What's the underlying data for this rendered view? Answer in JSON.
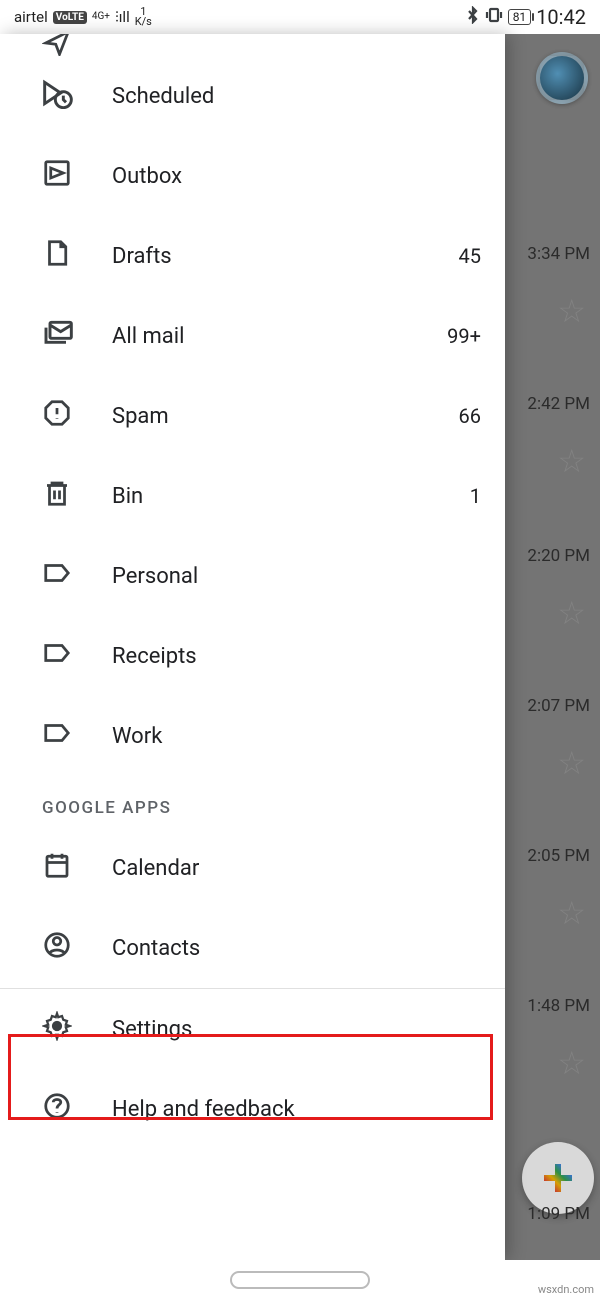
{
  "statusbar": {
    "carrier": "airtel",
    "volte": "VoLTE",
    "netgen": "4G+",
    "speed_top": "1",
    "speed_unit": "K/s",
    "battery": "81",
    "time": "10:42"
  },
  "drawer": {
    "items": [
      {
        "id": "sent",
        "label": "Sent",
        "count": ""
      },
      {
        "id": "scheduled",
        "label": "Scheduled",
        "count": ""
      },
      {
        "id": "outbox",
        "label": "Outbox",
        "count": ""
      },
      {
        "id": "drafts",
        "label": "Drafts",
        "count": "45"
      },
      {
        "id": "allmail",
        "label": "All mail",
        "count": "99+"
      },
      {
        "id": "spam",
        "label": "Spam",
        "count": "66"
      },
      {
        "id": "bin",
        "label": "Bin",
        "count": "1"
      },
      {
        "id": "personal",
        "label": "Personal",
        "count": ""
      },
      {
        "id": "receipts",
        "label": "Receipts",
        "count": ""
      },
      {
        "id": "work",
        "label": "Work",
        "count": ""
      }
    ],
    "section_google_apps": "GOOGLE APPS",
    "google_apps": [
      {
        "id": "calendar",
        "label": "Calendar"
      },
      {
        "id": "contacts",
        "label": "Contacts"
      }
    ],
    "footer": [
      {
        "id": "settings",
        "label": "Settings",
        "highlighted": true
      },
      {
        "id": "help",
        "label": "Help and feedback"
      }
    ]
  },
  "background": {
    "times": [
      "3:34 PM",
      "2:42 PM",
      "2:20 PM",
      "2:07 PM",
      "2:05 PM",
      "1:48 PM",
      "1:09 PM"
    ]
  },
  "watermark": "wsxdn.com"
}
